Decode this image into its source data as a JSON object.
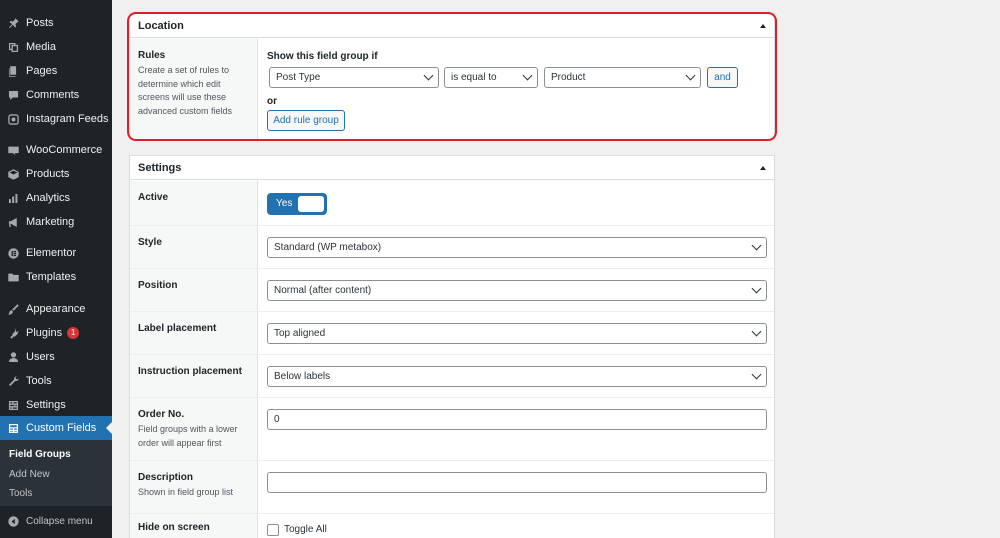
{
  "sidebar": {
    "items": [
      {
        "label": "Posts",
        "icon": "pin-icon"
      },
      {
        "label": "Media",
        "icon": "media-icon"
      },
      {
        "label": "Pages",
        "icon": "pages-icon"
      },
      {
        "label": "Comments",
        "icon": "comments-icon"
      },
      {
        "label": "Instagram Feeds",
        "icon": "instagram-icon"
      },
      {
        "label": "WooCommerce",
        "icon": "woocommerce-icon"
      },
      {
        "label": "Products",
        "icon": "products-icon"
      },
      {
        "label": "Analytics",
        "icon": "analytics-icon"
      },
      {
        "label": "Marketing",
        "icon": "megaphone-icon"
      },
      {
        "label": "Elementor",
        "icon": "elementor-icon"
      },
      {
        "label": "Templates",
        "icon": "folder-icon"
      },
      {
        "label": "Appearance",
        "icon": "brush-icon"
      },
      {
        "label": "Plugins",
        "icon": "plug-icon",
        "badge": "1"
      },
      {
        "label": "Users",
        "icon": "users-icon"
      },
      {
        "label": "Tools",
        "icon": "wrench-icon"
      },
      {
        "label": "Settings",
        "icon": "settings-icon"
      },
      {
        "label": "Custom Fields",
        "icon": "custom-fields-icon",
        "current": true
      }
    ],
    "submenu": [
      "Field Groups",
      "Add New",
      "Tools"
    ],
    "collapse_label": "Collapse menu"
  },
  "location": {
    "title": "Location",
    "rules_label": "Rules",
    "rules_desc": "Create a set of rules to determine which edit screens will use these advanced custom fields",
    "show_if_label": "Show this field group if",
    "param_value": "Post Type",
    "operator_value": "is equal to",
    "value_value": "Product",
    "and_label": "and",
    "or_label": "or",
    "add_rule_group_label": "Add rule group"
  },
  "settings": {
    "title": "Settings",
    "active": {
      "label": "Active",
      "value": "Yes"
    },
    "style": {
      "label": "Style",
      "value": "Standard (WP metabox)"
    },
    "position": {
      "label": "Position",
      "value": "Normal (after content)"
    },
    "label_placement": {
      "label": "Label placement",
      "value": "Top aligned"
    },
    "instruction_placement": {
      "label": "Instruction placement",
      "value": "Below labels"
    },
    "order_no": {
      "label": "Order No.",
      "desc": "Field groups with a lower order will appear first",
      "value": "0"
    },
    "description": {
      "label": "Description",
      "desc": "Shown in field group list",
      "value": ""
    },
    "hide_on_screen": {
      "label": "Hide on screen",
      "toggle_all_label": "Toggle All"
    }
  },
  "colors": {
    "accent": "#2271b1",
    "sidebar_bg": "#1d2327",
    "highlight": "#e11d2a",
    "badge": "#d63638"
  }
}
